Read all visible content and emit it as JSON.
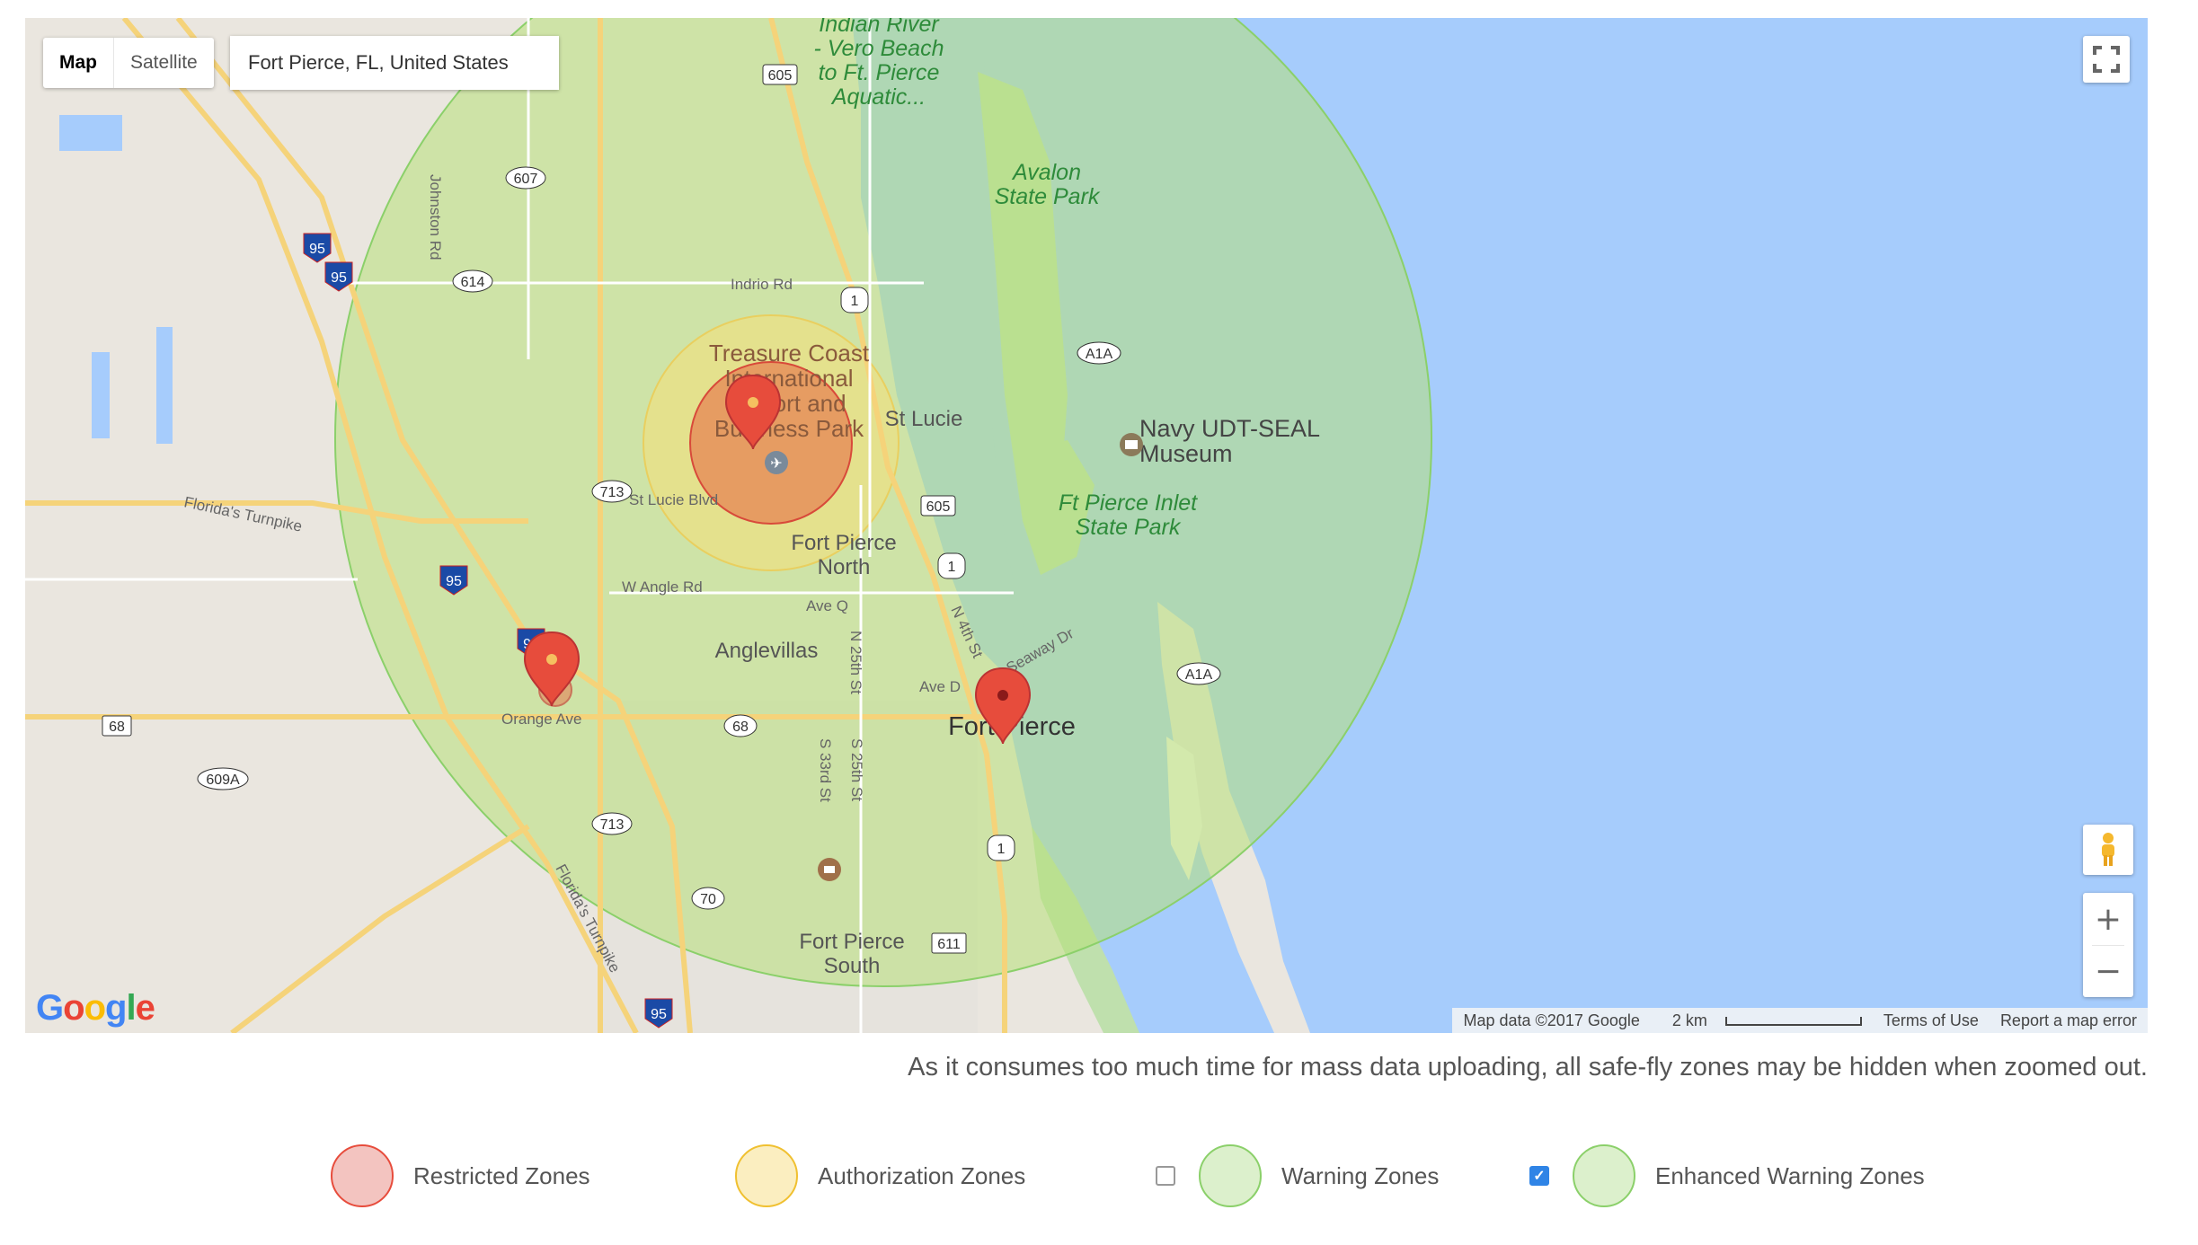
{
  "map_type": {
    "map_label": "Map",
    "satellite_label": "Satellite",
    "selected": "Map"
  },
  "search": {
    "value": "Fort Pierce, FL, United States"
  },
  "place_labels": {
    "indian_river_1": "Indian River",
    "indian_river_2": "- Vero Beach",
    "indian_river_3": "to Ft. Pierce",
    "indian_river_4": "Aquatic...",
    "avalon_1": "Avalon",
    "avalon_2": "State Park",
    "airport_1": "Treasure Coast",
    "airport_2": "International",
    "airport_3": "Airport and",
    "airport_4": "Business Park",
    "st_lucie": "St Lucie",
    "navy_1": "Navy UDT-SEAL",
    "navy_2": "Museum",
    "inlet_1": "Ft Pierce Inlet",
    "inlet_2": "State Park",
    "fp_north_1": "Fort Pierce",
    "fp_north_2": "North",
    "anglevillas": "Anglevillas",
    "fort_pierce": "Fort Pierce",
    "fp_south_1": "Fort Pierce",
    "fp_south_2": "South"
  },
  "road_labels": {
    "indrio": "Indrio Rd",
    "johnston": "Johnston Rd",
    "turnpike": "Florida's Turnpike",
    "turnpike2": "Florida's Turnpike",
    "st_lucie_blvd": "St Lucie Blvd",
    "w_angle": "W Angle Rd",
    "ave_q": "Ave Q",
    "ave_d": "Ave D",
    "n25": "N 25th St",
    "s25": "S 25th St",
    "s33": "S 33rd St",
    "n4th": "N 4th St",
    "seaway": "Seaway Dr",
    "orange": "Orange Ave"
  },
  "shields": {
    "r605a": "605",
    "r607": "607",
    "r614": "614",
    "i95a": "95",
    "i95b": "95",
    "us1a": "1",
    "a1a_1": "A1A",
    "r713a": "713",
    "r605b": "605",
    "us1b": "1",
    "i95c": "95",
    "i95d": "95",
    "a1a_2": "A1A",
    "r68a": "68",
    "r68b": "68",
    "r609a": "609A",
    "r713b": "713",
    "us1c": "1",
    "r70": "70",
    "r611": "611",
    "i95e": "95"
  },
  "map_icons": [
    "airport-icon",
    "museum-icon",
    "school-icon",
    "pegman-icon",
    "fullscreen-icon"
  ],
  "zones": {
    "restricted": {
      "color": "#e74c3c"
    },
    "authorization": {
      "color": "#f0d060"
    },
    "warning": {
      "color": "#8bd06a"
    }
  },
  "google_logo": {
    "g1": "G",
    "o1": "o",
    "o2": "o",
    "g2": "g",
    "l": "l",
    "e": "e"
  },
  "attribution": {
    "map_data": "Map data ©2017 Google",
    "scale": "2 km",
    "terms": "Terms of Use",
    "report": "Report a map error"
  },
  "zoom": {
    "in": "+",
    "out": "−"
  },
  "notice": "As it consumes too much time for mass data uploading, all safe-fly zones may be hidden when zoomed out.",
  "legend": {
    "restricted": {
      "label": "Restricted Zones",
      "color": "#e74c3c"
    },
    "authorization": {
      "label": "Authorization Zones",
      "color": "#f0c030"
    },
    "warning": {
      "label": "Warning Zones",
      "color": "#8bd06a",
      "checked": false
    },
    "enhanced": {
      "label": "Enhanced Warning Zones",
      "color": "#8bd06a",
      "checked": true,
      "check_glyph": "✓"
    }
  }
}
